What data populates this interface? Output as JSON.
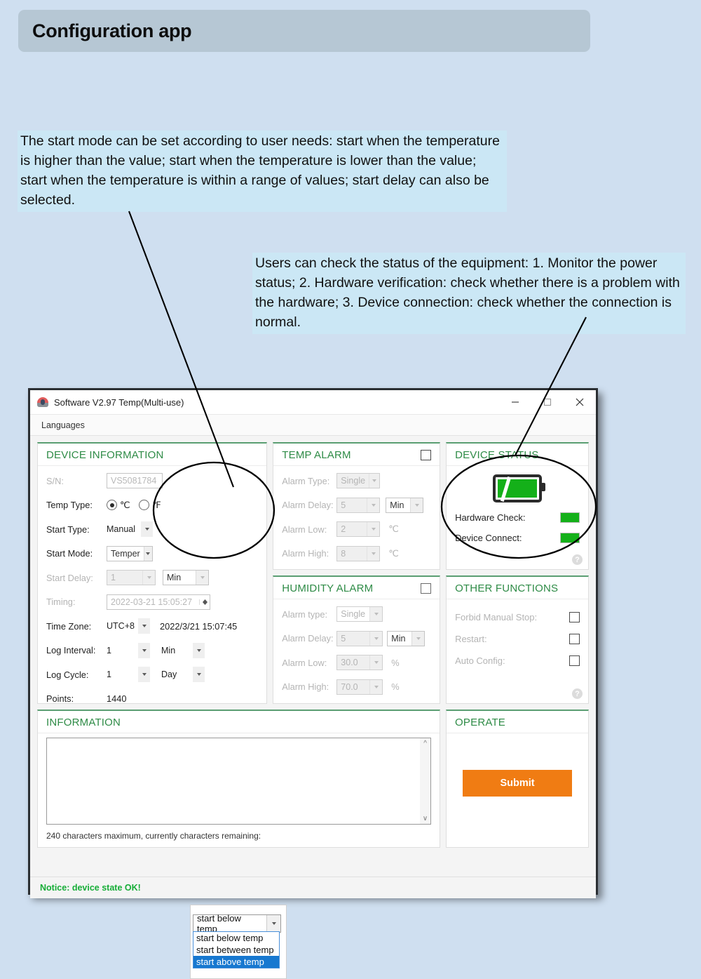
{
  "banner": {
    "title": "Configuration app"
  },
  "notes": {
    "note1": "The start mode can be set according to user needs: start when the temperature is higher than the value; start when the temperature is lower than the value; start when the temperature is within a range of values; start delay can also be selected.",
    "note2": "Users can check the status of the equipment: 1. Monitor the power status; 2. Hardware verification: check whether there is a problem with the hardware; 3. Device connection: check whether the connection is normal."
  },
  "window": {
    "title": "Software V2.97 Temp(Multi-use)",
    "minimize": "–",
    "maximize": "□",
    "close": "✕",
    "menu": [
      "Languages"
    ]
  },
  "device_information": {
    "title": "DEVICE INFORMATION",
    "sn_label": "S/N:",
    "sn_value": "VS5081784",
    "temp_type_label": "Temp Type:",
    "temp_type_options": [
      "℃",
      "℉"
    ],
    "temp_type_selected": "℃",
    "start_type_label": "Start Type:",
    "start_type_value": "Manual",
    "start_mode_label": "Start Mode:",
    "start_mode_value": "Temper",
    "start_delay_label": "Start Delay:",
    "start_delay_value": "1",
    "start_delay_unit": "Min",
    "timing_label": "Timing:",
    "timing_value": "2022-03-21 15:05:27",
    "time_zone_label": "Time Zone:",
    "time_zone_value": "UTC+8",
    "clock_value": "2022/3/21 15:07:45",
    "log_interval_label": "Log Interval:",
    "log_interval_value": "1",
    "log_interval_unit": "Min",
    "log_cycle_label": "Log Cycle:",
    "log_cycle_value": "1",
    "log_cycle_unit": "Day",
    "points_label": "Points:",
    "points_value": "1440"
  },
  "start_mode_dropdown": {
    "selected": "start below temp",
    "options": [
      "start below temp",
      "start between temp",
      "start above temp"
    ],
    "highlighted": "start above temp"
  },
  "temp_alarm": {
    "title": "TEMP ALARM",
    "enabled": false,
    "alarm_type_label": "Alarm Type:",
    "alarm_type_value": "Single",
    "alarm_delay_label": "Alarm Delay:",
    "alarm_delay_value": "5",
    "alarm_delay_unit": "Min",
    "alarm_low_label": "Alarm Low:",
    "alarm_low_value": "2",
    "alarm_low_unit": "℃",
    "alarm_high_label": "Alarm High:",
    "alarm_high_value": "8",
    "alarm_high_unit": "℃"
  },
  "humidity_alarm": {
    "title": "HUMIDITY ALARM",
    "enabled": false,
    "alarm_type_label": "Alarm type:",
    "alarm_type_value": "Single",
    "alarm_delay_label": "Alarm Delay:",
    "alarm_delay_value": "5",
    "alarm_delay_unit": "Min",
    "alarm_low_label": "Alarm Low:",
    "alarm_low_value": "30.0",
    "alarm_low_unit": "%",
    "alarm_high_label": "Alarm High:",
    "alarm_high_value": "70.0",
    "alarm_high_unit": "%"
  },
  "device_status": {
    "title": "DEVICE STATUS",
    "battery_icon": "battery-full-icon",
    "hardware_check_label": "Hardware Check:",
    "hardware_check_state": "ok",
    "device_connect_label": "Device Connect:",
    "device_connect_state": "ok",
    "help": "?"
  },
  "other_functions": {
    "title": "OTHER FUNCTIONS",
    "items": [
      {
        "label": "Forbid Manual Stop:",
        "checked": false
      },
      {
        "label": "Restart:",
        "checked": false
      },
      {
        "label": "Auto Config:",
        "checked": false
      }
    ],
    "help": "?"
  },
  "information": {
    "title": "INFORMATION",
    "textarea_value": "",
    "hint": "240 characters maximum, currently characters remaining:"
  },
  "operate": {
    "title": "OPERATE",
    "submit_label": "Submit"
  },
  "statusbar": {
    "notice": "Notice: device state OK!"
  },
  "colors": {
    "page_background": "#cfdff0",
    "banner_background": "#b6c7d4",
    "note_background": "#cbe7f5",
    "panel_accent": "#5a9e72",
    "panel_title": "#2e8b46",
    "submit_button": "#f07c13",
    "status_ok": "#16ad37",
    "led_green": "#14b019",
    "dropdown_highlight": "#1778d0"
  }
}
